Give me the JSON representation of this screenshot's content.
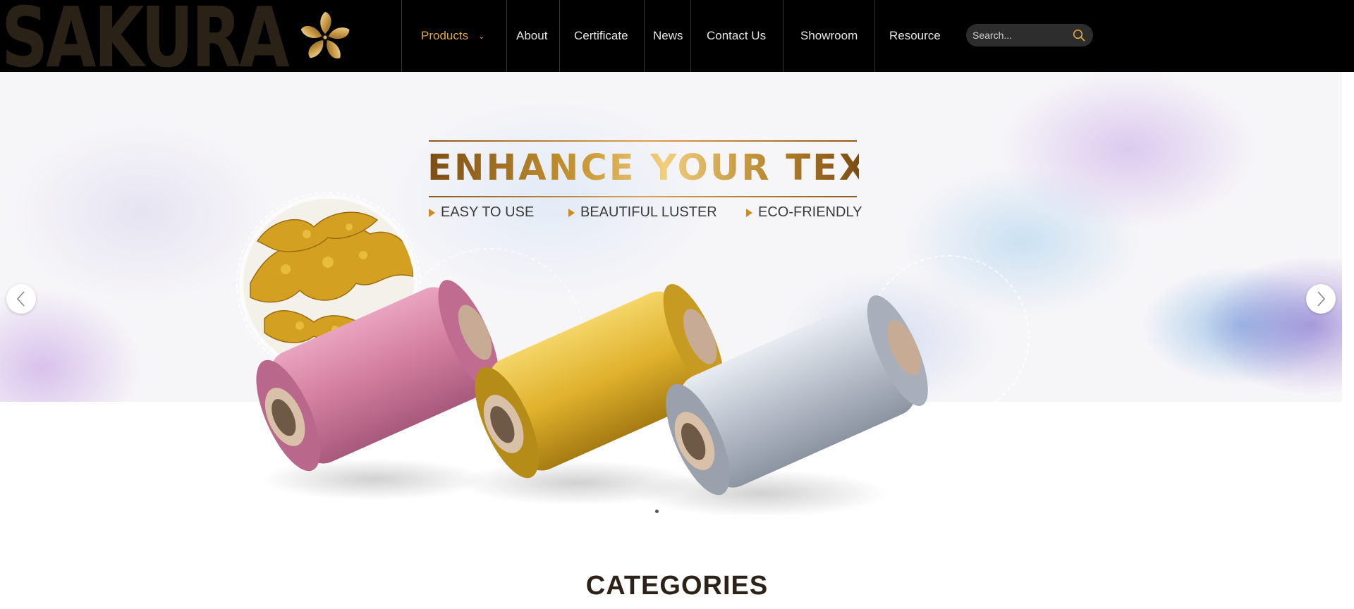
{
  "brand": {
    "wordmark": "SAKURA",
    "logo_icon": "flower-logo-icon"
  },
  "nav": {
    "items": [
      {
        "label": "Products",
        "active": true,
        "has_dropdown": true
      },
      {
        "label": "About"
      },
      {
        "label": "Certificate"
      },
      {
        "label": "News"
      },
      {
        "label": "Contact Us"
      },
      {
        "label": "Showroom"
      },
      {
        "label": "Resource"
      }
    ]
  },
  "search": {
    "placeholder": "Search...",
    "icon": "search-icon"
  },
  "hero": {
    "title": "ENHANCE YOUR TEXTILE",
    "features": [
      "EASY TO USE",
      "BEAUTIFUL LUSTER",
      "ECO-FRIENDLY"
    ],
    "spool_colors": [
      "#d88aa8",
      "#e6bf3a",
      "#c7ccd6"
    ],
    "prev_icon": "chevron-left-icon",
    "next_icon": "chevron-right-icon"
  },
  "section": {
    "heading": "CATEGORIES"
  },
  "colors": {
    "accent": "#e2a640",
    "header_bg": "#000000",
    "gold": "#b57f22"
  }
}
